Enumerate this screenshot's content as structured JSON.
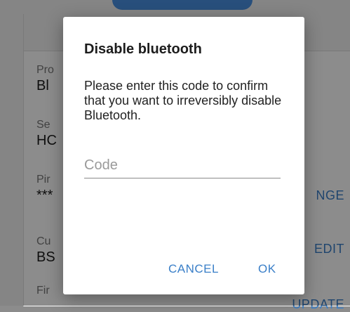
{
  "background": {
    "fields": [
      {
        "label": "Pro",
        "value": "Bl"
      },
      {
        "label": "Se",
        "value": "HC"
      },
      {
        "label": "Pir",
        "value": "***",
        "action": "NGE"
      },
      {
        "label": "Cu",
        "value": "BS",
        "action": "EDIT"
      },
      {
        "label": "Fir",
        "value": "",
        "action": "UPDATE"
      }
    ]
  },
  "dialog": {
    "title": "Disable bluetooth",
    "message": "Please enter this code to confirm that you want to irreversibly disable Bluetooth.",
    "code_placeholder": "Code",
    "code_value": "",
    "cancel_label": "CANCEL",
    "ok_label": "OK"
  },
  "colors": {
    "accent": "#3a7fc8",
    "scrim": "#000000"
  }
}
